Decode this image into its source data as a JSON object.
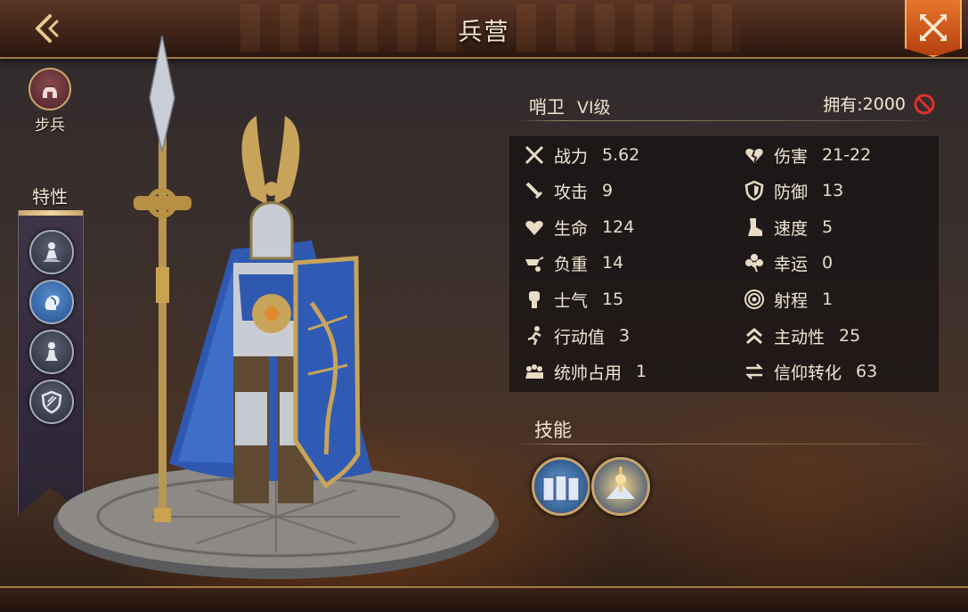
{
  "header": {
    "title": "兵营",
    "back_icon": "chevron-left-icon",
    "close_icon": "close-x-icon"
  },
  "unit_type": {
    "label": "步兵",
    "icon": "helmet-icon"
  },
  "traits": {
    "title": "特性",
    "items": [
      {
        "icon": "soldier-rubble-icon"
      },
      {
        "icon": "helmet-profile-icon",
        "active": true
      },
      {
        "icon": "pawn-figure-icon"
      },
      {
        "icon": "shield-icon"
      }
    ]
  },
  "unit": {
    "name": "哨卫",
    "grade": "VI级",
    "owned_label": "拥有:",
    "owned_value": "2000",
    "owned_icon": "ban-icon"
  },
  "stats": {
    "left": [
      {
        "label": "战力",
        "value": "5.62",
        "icon": "crossed-swords-icon"
      },
      {
        "label": "攻击",
        "value": "9",
        "icon": "sword-icon"
      },
      {
        "label": "生命",
        "value": "124",
        "icon": "heart-icon"
      },
      {
        "label": "负重",
        "value": "14",
        "icon": "wheelbarrow-icon"
      },
      {
        "label": "士气",
        "value": "15",
        "icon": "fist-icon"
      },
      {
        "label": "行动值",
        "value": "3",
        "icon": "running-icon"
      },
      {
        "label": "统帅占用",
        "value": "1",
        "icon": "troops-icon"
      }
    ],
    "right": [
      {
        "label": "伤害",
        "value": "21-22",
        "icon": "broken-heart-icon"
      },
      {
        "label": "防御",
        "value": "13",
        "icon": "shield-icon"
      },
      {
        "label": "速度",
        "value": "5",
        "icon": "boot-icon"
      },
      {
        "label": "幸运",
        "value": "0",
        "icon": "clover-icon"
      },
      {
        "label": "射程",
        "value": "1",
        "icon": "target-icon"
      },
      {
        "label": "主动性",
        "value": "25",
        "icon": "double-chevron-up-icon"
      },
      {
        "label": "信仰转化",
        "value": "63",
        "icon": "swap-arrows-icon"
      }
    ]
  },
  "skills": {
    "title": "技能",
    "items": [
      {
        "icon": "shield-wall-icon"
      },
      {
        "icon": "sentinel-guard-icon"
      }
    ]
  },
  "colors": {
    "accent_orange": "#d8601f",
    "gold_trim": "#c9a46a",
    "text_light": "#f1e6d4",
    "stat_icon": "#e8dcc6",
    "ban_red": "#e0312a"
  }
}
